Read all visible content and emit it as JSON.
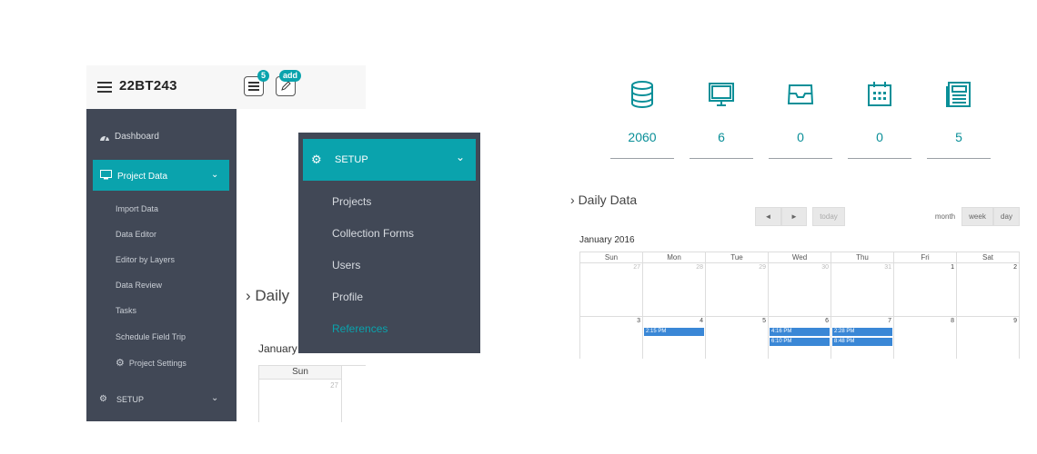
{
  "app": {
    "project_id": "22BT243",
    "badge_count": "5",
    "add_badge": "add"
  },
  "sidebar": {
    "dashboard": "Dashboard",
    "project_data": "Project Data",
    "sub_items": [
      "Import Data",
      "Data Editor",
      "Editor by Layers",
      "Data Review",
      "Tasks",
      "Schedule Field Trip",
      "Project Settings"
    ],
    "setup": "SETUP"
  },
  "left_page": {
    "daily": "Daily",
    "month": "January",
    "day_sun": "Sun",
    "date_27": "27"
  },
  "setup_menu": {
    "title": "SETUP",
    "items": [
      "Projects",
      "Collection Forms",
      "Users",
      "Profile",
      "References"
    ],
    "highlight_color": "#0aa3ad"
  },
  "stats": [
    {
      "icon": "database-icon",
      "value": "2060"
    },
    {
      "icon": "monitor-icon",
      "value": "6"
    },
    {
      "icon": "inbox-icon",
      "value": "0"
    },
    {
      "icon": "calendar-icon",
      "value": "0"
    },
    {
      "icon": "newspaper-icon",
      "value": "5"
    }
  ],
  "calendar": {
    "section_title": "Daily Data",
    "prev": "◄",
    "next": "►",
    "today": "today",
    "views": [
      "month",
      "week",
      "day"
    ],
    "month_title": "January 2016",
    "weekdays": [
      "Sun",
      "Mon",
      "Tue",
      "Wed",
      "Thu",
      "Fri",
      "Sat"
    ],
    "week1": [
      "27",
      "28",
      "29",
      "30",
      "31",
      "1",
      "2"
    ],
    "week2": [
      "3",
      "4",
      "5",
      "6",
      "7",
      "8",
      "9"
    ],
    "events": {
      "mon": [
        "2:15 PM"
      ],
      "wed": [
        "4:16 PM",
        "6:10 PM"
      ],
      "thu": [
        "2:28 PM",
        "8:48 PM"
      ]
    },
    "event_color": "#3a87d6"
  }
}
